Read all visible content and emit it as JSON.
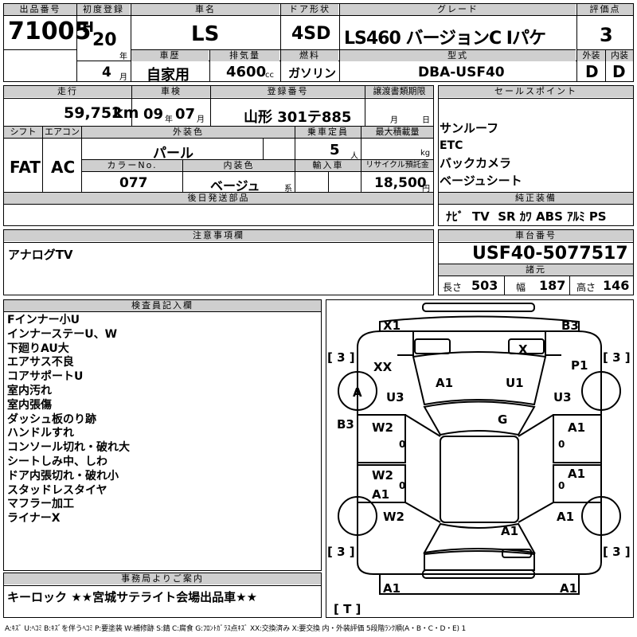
{
  "header": {
    "lot_label": "出品番号",
    "lot_number": "71005",
    "first_reg_label": "初度登録",
    "era": "H",
    "first_reg_year": "20",
    "year_unit": "年",
    "first_reg_month": "4",
    "month_unit": "月",
    "car_name_label": "車名",
    "car_name": "LS",
    "door_label": "ドア形状",
    "door": "4SD",
    "grade_label": "グレード",
    "grade": "LS460 バージョンC Iパケ",
    "score_label": "評価点",
    "score": "3",
    "history_label": "車歴",
    "history": "自家用",
    "displacement_label": "排気量",
    "displacement": "4600",
    "cc_unit": "cc",
    "fuel_label": "燃料",
    "fuel": "ガソリン",
    "model_label": "型式",
    "model": "DBA-USF40",
    "exterior_grade_label": "外装",
    "exterior_grade": "D",
    "interior_grade_label": "内装",
    "interior_grade": "D"
  },
  "row2": {
    "mileage_label": "走行",
    "mileage": "59,752",
    "km_unit": "km",
    "inspection_label": "車検",
    "insp_year": "09",
    "insp_month": "07",
    "reg_no_label": "登録番号",
    "reg_no": "山形 301テ885",
    "transfer_label": "譲渡書類期限",
    "transfer_month": "月",
    "transfer_day": "日",
    "shift_label": "シフト",
    "shift": "FAT",
    "ac_label": "エアコン",
    "ac": "AC",
    "color_label": "外装色",
    "color": "パール",
    "capacity_label": "乗車定員",
    "capacity": "5",
    "capacity_unit": "人",
    "load_label": "最大積載量",
    "load_unit": "kg",
    "color_no_label": "カラーNo.",
    "color_no": "077",
    "interior_color_label": "内装色",
    "interior_color": "ベージュ",
    "interior_color_unit": "系",
    "import_label": "輸入車",
    "recycle_label": "リサイクル預託金",
    "recycle": "18,500",
    "yen_unit": "円",
    "later_parts_label": "後日発送部品"
  },
  "sales": {
    "label": "セールスポイント",
    "points": [
      "サンルーフ",
      "ETC",
      "バックカメラ",
      "ベージュシート"
    ],
    "equipment_label": "純正装備",
    "equipment": "ﾅﾋﾞ  TV  SR ｶﾜ ABS ｱﾙﾐ PS"
  },
  "caution": {
    "label": "注意事項欄",
    "text": "アナログTV"
  },
  "chassis": {
    "label": "車台番号",
    "number": "USF40-5077517",
    "dims_label": "諸元",
    "length_label": "長さ",
    "length": "503",
    "width_label": "幅",
    "width": "187",
    "height_label": "高さ",
    "height": "146"
  },
  "inspector": {
    "label": "検査員記入欄",
    "notes": [
      "Fインナー小U",
      "インナーステーU、W",
      "下廻りAU大",
      "エアサス不良",
      "コアサポートU",
      "室内汚れ",
      "室内張傷",
      "ダッシュ板のり跡",
      "ハンドルすれ",
      "コンソール切れ・破れ大",
      "シートしみ中、しわ",
      "ドア内張切れ・破れ小",
      "スタッドレスタイヤ",
      "マフラー加工",
      "ライナーX"
    ]
  },
  "diagram": {
    "marks": {
      "x1": "X1",
      "b3_top": "B3",
      "tire_fl": "[ 3 ]",
      "tire_fr": "[ 3 ]",
      "xx": "XX",
      "x_glass": "X",
      "p1": "P1",
      "a_left": "A",
      "a1_hood_l": "A1",
      "u1": "U1",
      "u3_l": "U3",
      "u3_r": "U3",
      "b3_left": "B3",
      "w2_fl": "W2",
      "g_roof": "G",
      "a1_fr": "A1",
      "w2_rl": "W2",
      "a1_rr_door": "A1",
      "a1_rl": "A1",
      "w2_rear": "W2",
      "a1_trunk": "A1",
      "a1_rear_r": "A1",
      "tire_rl": "[ 3 ]",
      "tire_rr": "[ 3 ]",
      "a1_bumper_l": "A1",
      "a1_bumper_r": "A1",
      "t_spare": "[ T ]",
      "zero1": "0",
      "zero2": "0",
      "zero3": "0",
      "zero4": "0"
    }
  },
  "office": {
    "label": "事務局よりご案内",
    "text": "キーロック ★★宮城サテライト会場出品車★★"
  },
  "legend": "A:ｷｽﾞ U:ﾍｺﾐ B:ｷｽﾞを伴うﾍｺﾐ P:要塗装 W:補修跡 S:錆 C:腐食 G:ﾌﾛﾝﾄｶﾞﾗｽ点ｷｽﾞ XX:交換済み X:要交換 内・外装評価 5段階ﾗﾝｸ順(A・B・C・D・E) 1"
}
